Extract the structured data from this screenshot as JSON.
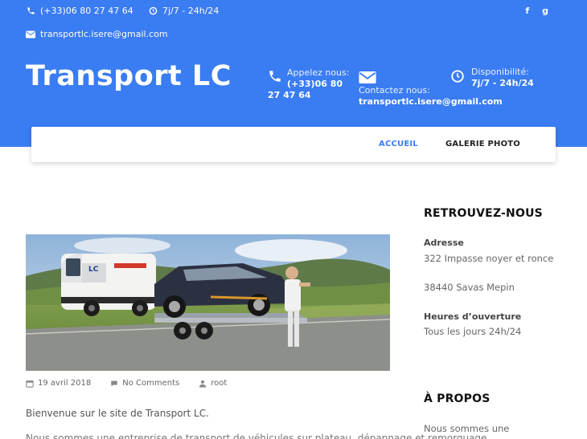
{
  "topbar": {
    "phone": "(+33)06 80 27 47 64",
    "hours": "7j/7 - 24h/24",
    "email": "transportlc.isere@gmail.com",
    "social": [
      "f",
      "g"
    ]
  },
  "header": {
    "logo": "Transport LC",
    "phone_label": "Appelez nous:",
    "phone_value_1": "(+33)06 80",
    "phone_value_2": "27 47 64",
    "contact_label": "Contactez nous:",
    "contact_value": "transportlc.isere@gmail.com",
    "dispo_label": "Disponibilité:",
    "dispo_value": "7j/7 - 24h/24"
  },
  "nav": {
    "items": [
      "ACCUEIL",
      "GALERIE PHOTO"
    ],
    "active": "ACCUEIL"
  },
  "post": {
    "image_alt": "Camionnette avec remorque transportant une voiture",
    "date": "19 avril 2018",
    "comments": "No Comments",
    "author": "root",
    "excerpt": "Bienvenue sur le site de Transport LC.",
    "excerpt_cut": "Nous sommes une entreprise de transport de véhicules sur plateau, dépannage et remorquage"
  },
  "sidebar": {
    "title1": "RETROUVEZ-NOUS",
    "address_label": "Adresse",
    "address_line1": "322 Impasse noyer et ronce",
    "address_line2": "38440 Savas Mepin",
    "hours_label": "Heures d’ouverture",
    "hours_value": "Tous les jours 24h/24",
    "title2": "À PROPOS",
    "about_text": "Nous sommes une"
  },
  "colors": {
    "brand": "#3a7cf2",
    "nav_active": "#3a7cf2"
  }
}
